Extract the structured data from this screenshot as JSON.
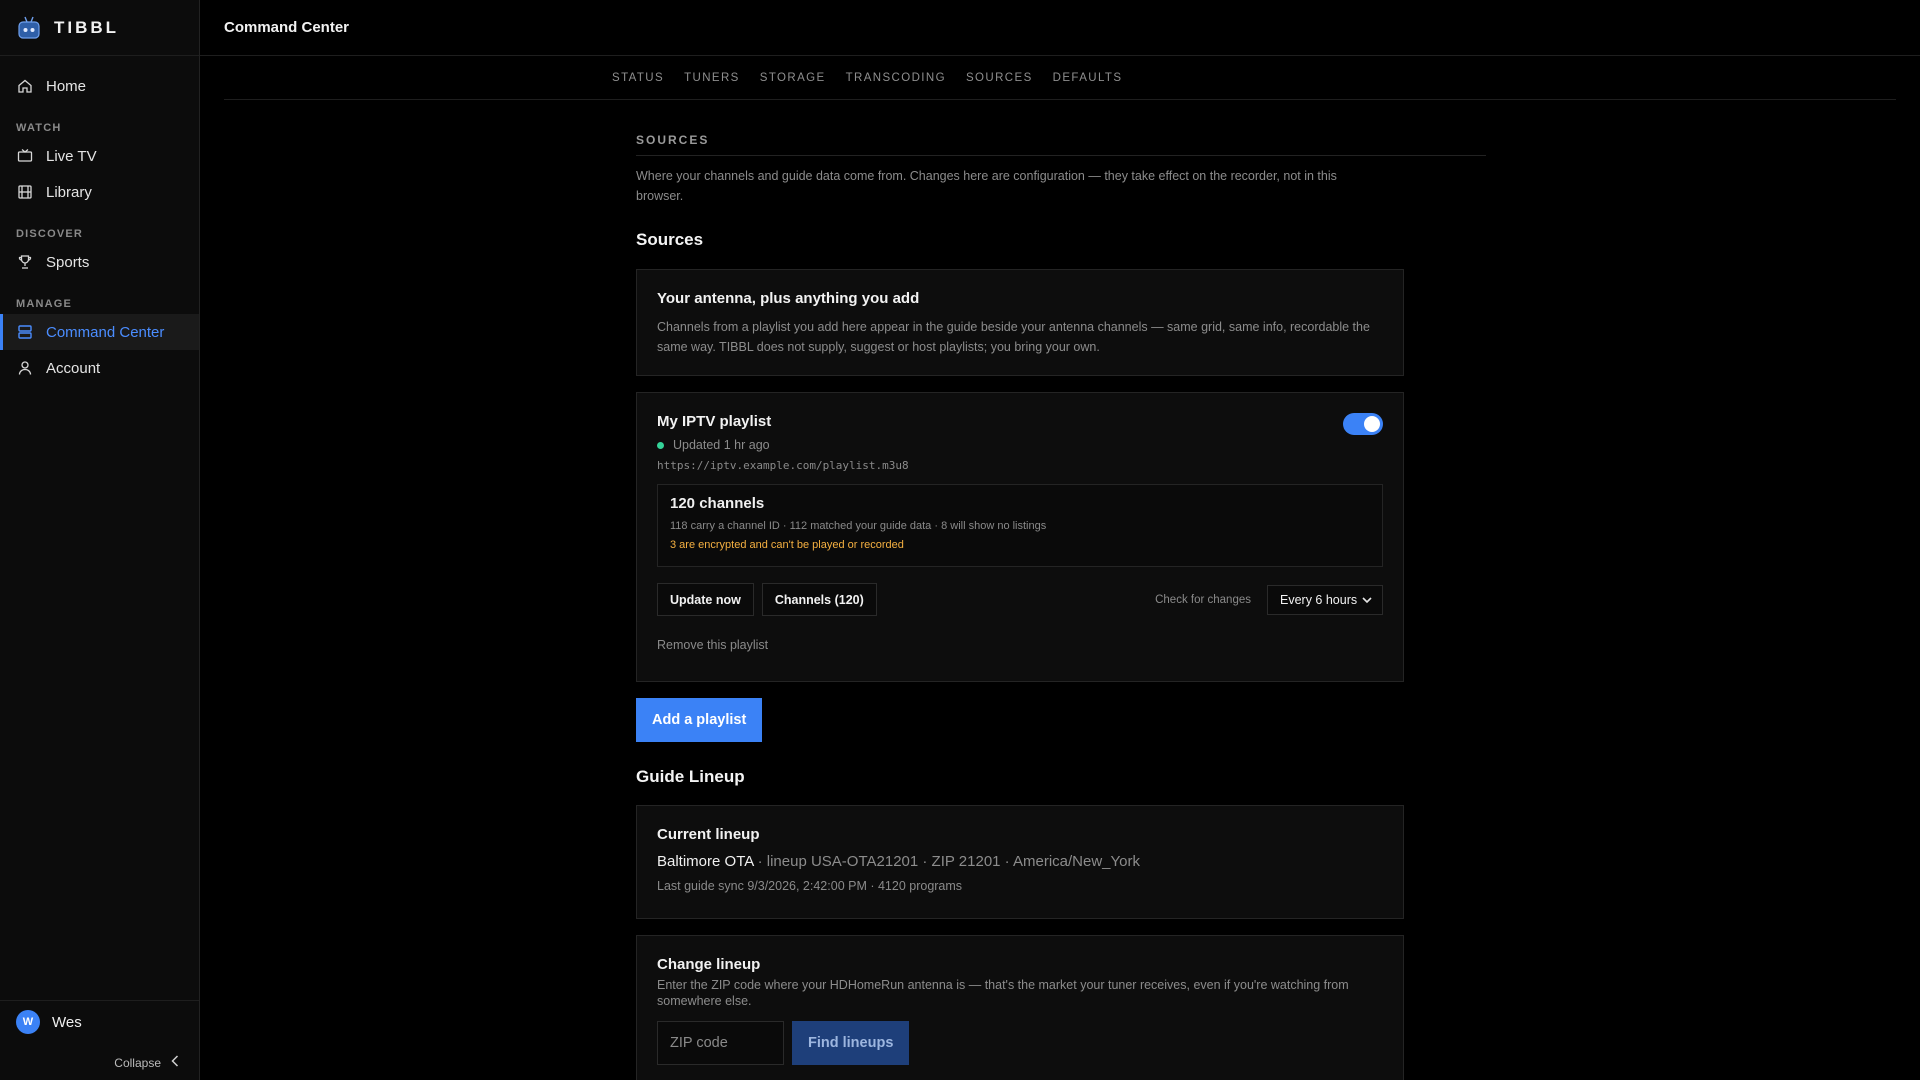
{
  "app": {
    "brand": "TIBBL",
    "page_title": "Command Center"
  },
  "sidebar": {
    "home": "Home",
    "sections": {
      "watch": "WATCH",
      "discover": "DISCOVER",
      "manage": "MANAGE"
    },
    "items": {
      "live_tv": "Live TV",
      "library": "Library",
      "sports": "Sports",
      "command_center": "Command Center",
      "account": "Account"
    },
    "active": "command_center",
    "user": {
      "initial": "W",
      "name": "Wes"
    },
    "collapse": "Collapse"
  },
  "tabs": [
    "STATUS",
    "TUNERS",
    "STORAGE",
    "TRANSCODING",
    "SOURCES",
    "DEFAULTS"
  ],
  "sources_section": {
    "title": "SOURCES",
    "description": "Where your channels and guide data come from. Changes here are configuration — they take effect on the recorder, not in this browser.",
    "heading": "Sources",
    "intro_card": {
      "title": "Your antenna, plus anything you add",
      "text": "Channels from a playlist you add here appear in the guide beside your antenna channels — same grid, same info, recordable the same way. TIBBL does not supply, suggest or host playlists; you bring your own."
    },
    "playlist": {
      "name": "My IPTV playlist",
      "enabled": true,
      "status": "Updated 1 hr ago",
      "status_color": "#34d399",
      "url": "https://iptv.example.com/playlist.m3u8",
      "channels_title": "120 channels",
      "channels_stats": "118 carry a channel ID · 112 matched your guide data · 8 will show no listings",
      "warning": "3 are encrypted and can't be played or recorded",
      "update_button": "Update now",
      "channels_button": "Channels (120)",
      "check_label": "Check for changes",
      "check_value": "Every 6 hours",
      "remove_link": "Remove this playlist"
    },
    "add_button": "Add a playlist"
  },
  "guide": {
    "heading": "Guide Lineup",
    "current": {
      "title": "Current lineup",
      "name": "Baltimore OTA",
      "details": " · lineup USA-OTA21201 · ZIP 21201 · America/New_York",
      "sync": "Last guide sync 9/3/2026, 2:42:00 PM · 4120 programs"
    },
    "change": {
      "title": "Change lineup",
      "text": "Enter the ZIP code where your HDHomeRun antenna is — that's the market your tuner receives, even if you're watching from somewhere else.",
      "zip_placeholder": "ZIP code",
      "zip_value": "",
      "find_button": "Find lineups"
    }
  },
  "colors": {
    "accent": "#3b82f6",
    "warning": "#f5b041",
    "ok": "#34d399"
  }
}
